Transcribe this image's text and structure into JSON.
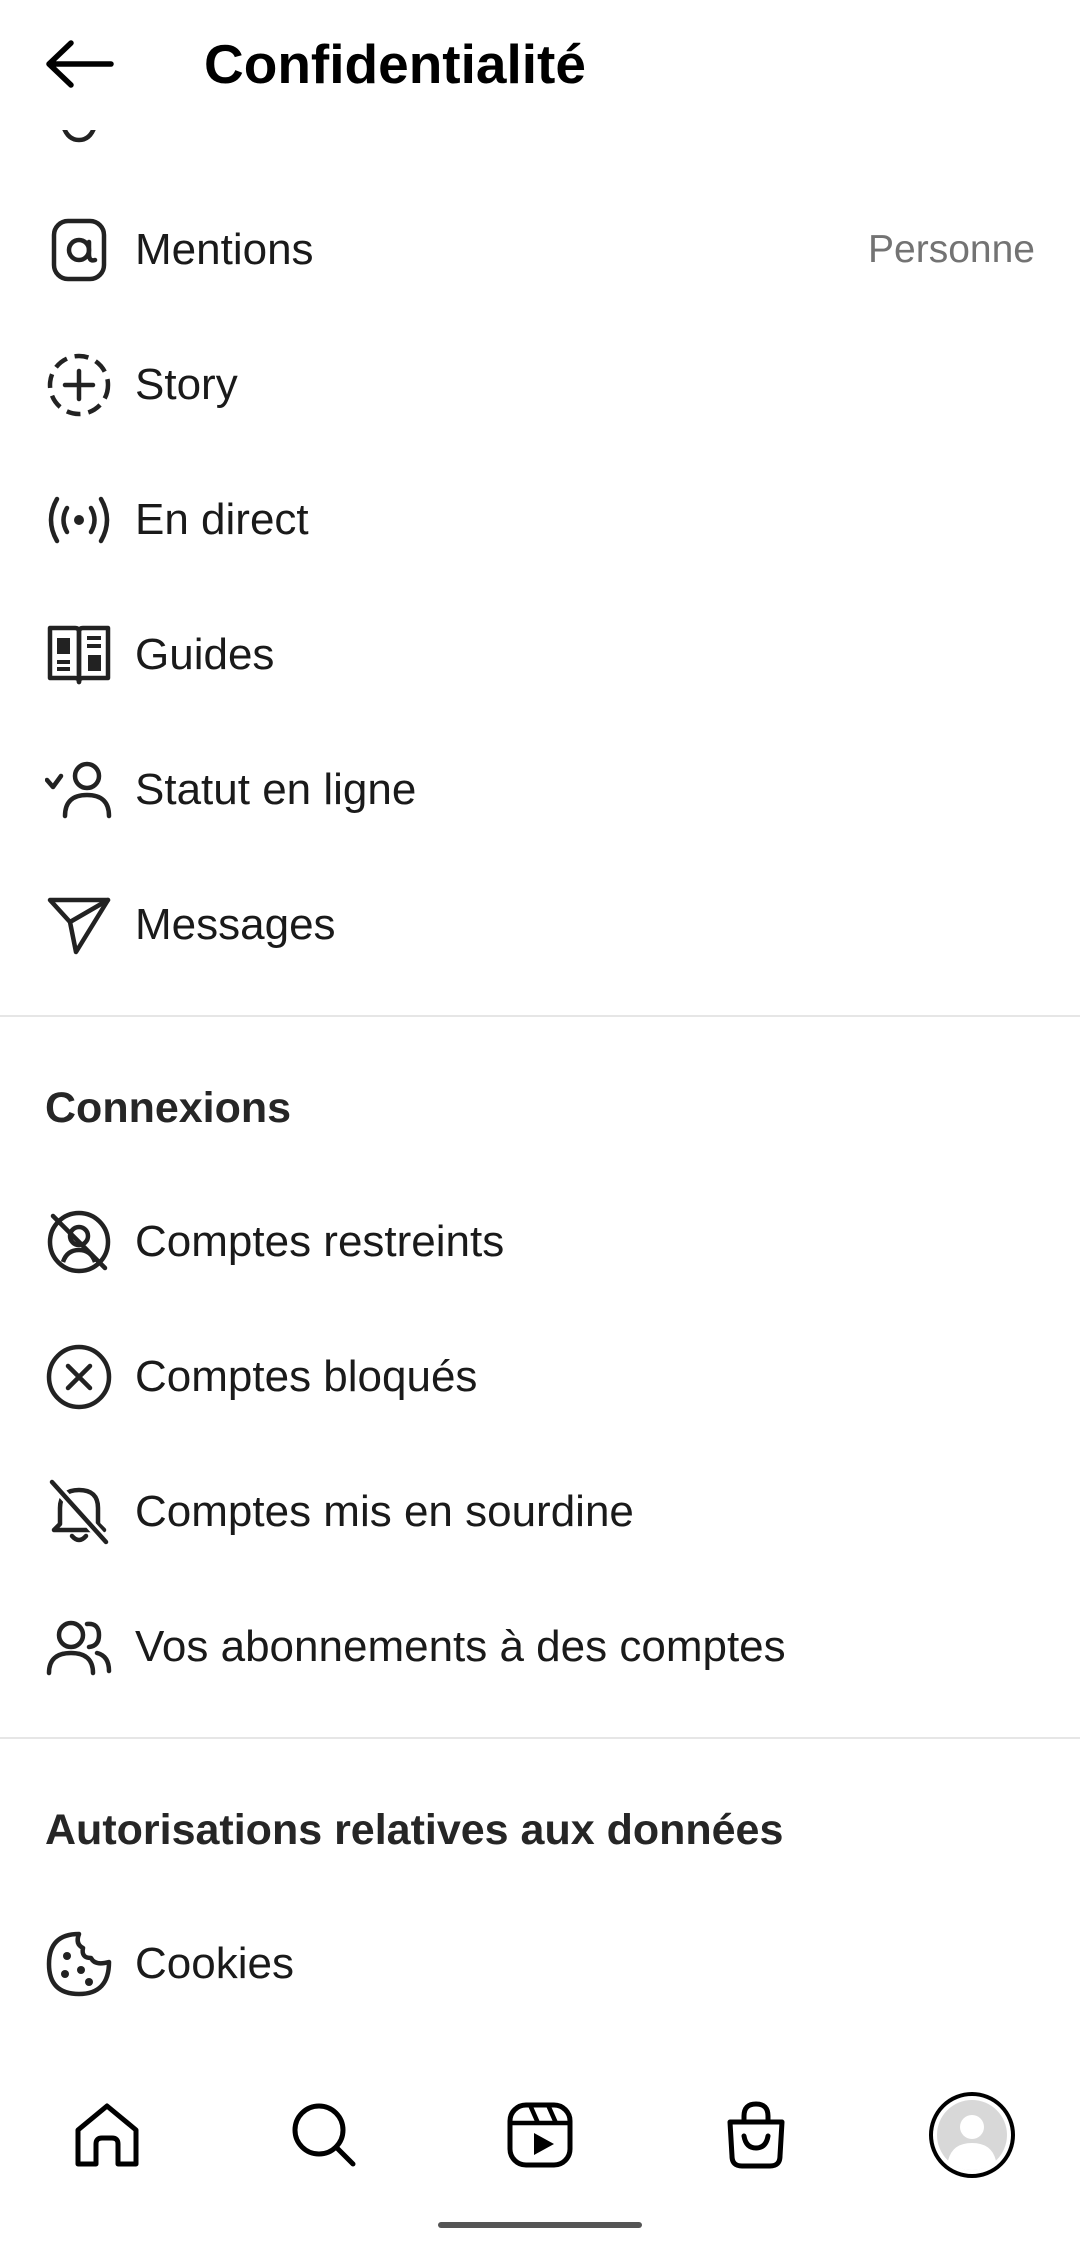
{
  "header": {
    "title": "Confidentialité",
    "back_icon": "arrow-left-icon"
  },
  "interactions": [
    {
      "label": "Mentions",
      "value": "Personne",
      "icon": "at-sign-icon"
    },
    {
      "label": "Story",
      "icon": "story-add-icon"
    },
    {
      "label": "En direct",
      "icon": "live-broadcast-icon"
    },
    {
      "label": "Guides",
      "icon": "guide-book-icon"
    },
    {
      "label": "Statut en ligne",
      "icon": "user-check-icon"
    },
    {
      "label": "Messages",
      "icon": "paper-plane-icon"
    }
  ],
  "connections": {
    "title": "Connexions",
    "items": [
      {
        "label": "Comptes restreints",
        "icon": "restricted-icon"
      },
      {
        "label": "Comptes bloqués",
        "icon": "blocked-icon"
      },
      {
        "label": "Comptes mis en sourdine",
        "icon": "bell-off-icon"
      },
      {
        "label": "Vos abonnements à des comptes",
        "icon": "users-icon"
      }
    ]
  },
  "data_permissions": {
    "title": "Autorisations relatives aux données",
    "items": [
      {
        "label": "Cookies",
        "icon": "cookie-icon"
      }
    ]
  },
  "bottom_nav": [
    {
      "name": "home",
      "icon": "home-icon"
    },
    {
      "name": "search",
      "icon": "search-icon"
    },
    {
      "name": "reels",
      "icon": "reels-icon"
    },
    {
      "name": "shop",
      "icon": "shop-bag-icon"
    },
    {
      "name": "profile",
      "icon": "avatar-icon"
    }
  ]
}
